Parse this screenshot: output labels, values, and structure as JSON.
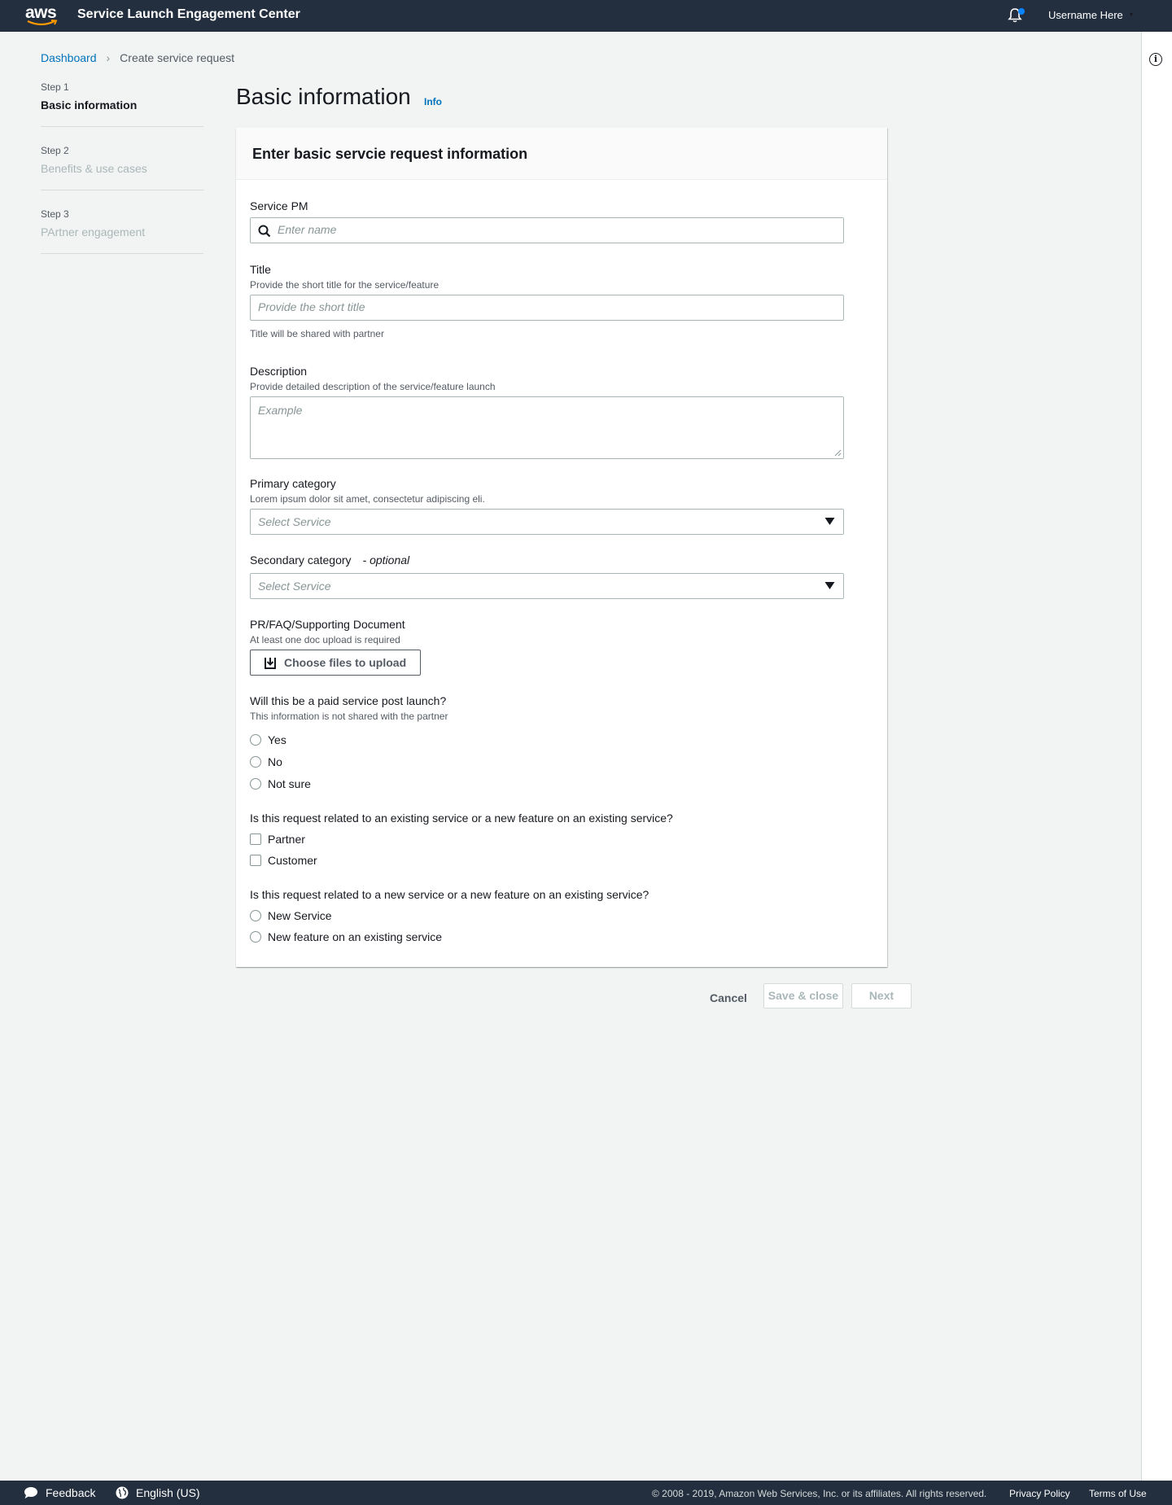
{
  "header": {
    "logo_text": "aws",
    "app_title": "Service Launch Engagement Center",
    "username": "Username Here",
    "caret": "▾"
  },
  "breadcrumb": {
    "root": "Dashboard",
    "separator": "›",
    "current": "Create service request"
  },
  "steps": [
    {
      "number": "Step 1",
      "label": "Basic information"
    },
    {
      "number": "Step 2",
      "label": "Benefits & use cases"
    },
    {
      "number": "Step 3",
      "label": "PArtner engagement"
    }
  ],
  "page": {
    "title": "Basic information",
    "info_link": "Info"
  },
  "form": {
    "header": "Enter basic servcie request information",
    "service_pm": {
      "label": "Service PM",
      "placeholder": "Enter name"
    },
    "title": {
      "label": "Title",
      "description": "Provide the short title for the service/feature",
      "placeholder": "Provide the short title",
      "hint": "Title will be shared with partner"
    },
    "description": {
      "label": "Description",
      "description": "Provide detailed description of the service/feature launch",
      "placeholder": "Example"
    },
    "primary_category": {
      "label": "Primary category",
      "description": "Lorem ipsum dolor sit amet, consectetur adipiscing eli.",
      "selected": "Select Service"
    },
    "secondary_category": {
      "label": "Secondary category",
      "optional": "- optional",
      "selected": "Select Service"
    },
    "document": {
      "label": "PR/FAQ/Supporting Document",
      "description": "At least one doc upload is required",
      "button": "Choose files to upload"
    },
    "paid_service": {
      "label": "Will this be a paid service post launch?",
      "description": "This information is not shared with the partner",
      "options": [
        "Yes",
        "No",
        "Not sure"
      ]
    },
    "existing_related": {
      "label": "Is this request related to an existing service or a new feature on an existing service?",
      "options": [
        "Partner",
        "Customer"
      ]
    },
    "new_related": {
      "label": "Is this request related to a new service or a new feature on an existing service?",
      "options": [
        "New Service",
        "New feature on an existing service"
      ]
    }
  },
  "actions": {
    "cancel": "Cancel",
    "save_close": "Save & close",
    "next": "Next"
  },
  "footer": {
    "feedback": "Feedback",
    "language": "English (US)",
    "copyright": "© 2008 - 2019, Amazon Web Services, Inc. or its affiliates. All rights reserved.",
    "privacy": "Privacy Policy",
    "terms": "Terms of Use"
  },
  "colors": {
    "nav": "#232f3e",
    "link": "#0073bb",
    "background": "#f2f3f3",
    "notification_dot": "#0a84ff",
    "aws_smile": "#ff9900"
  }
}
